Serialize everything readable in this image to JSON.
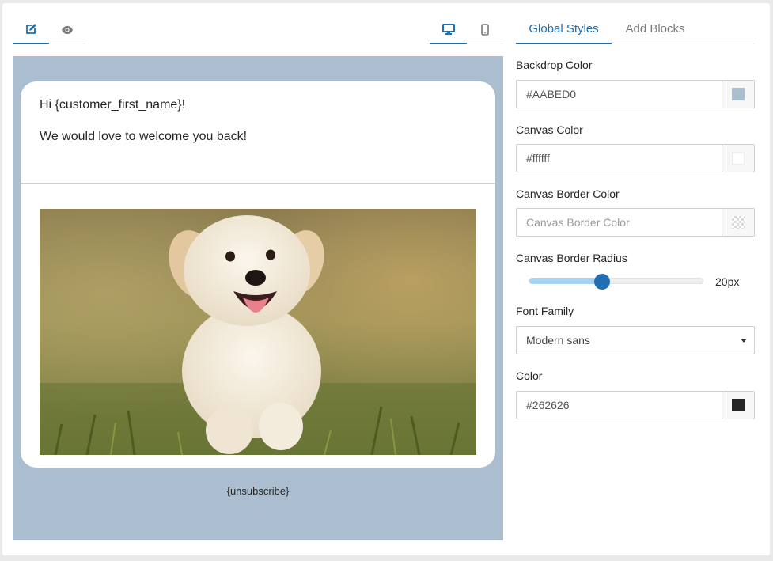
{
  "toolbar": {
    "edit_icon": "edit-pencil-icon",
    "preview_icon": "eye-icon",
    "desktop_icon": "desktop-monitor-icon",
    "mobile_icon": "mobile-phone-icon",
    "active_color": "#1f6fb2",
    "inactive_color": "#7a7a7a"
  },
  "email": {
    "greeting": "Hi {customer_first_name}!",
    "body": "We would love to welcome you back!",
    "image_icon": "puppy-photo",
    "footer": "{unsubscribe}"
  },
  "sidebar": {
    "tabs": [
      {
        "label": "Global Styles",
        "active": true
      },
      {
        "label": "Add Blocks",
        "active": false
      }
    ],
    "backdrop_color": {
      "label": "Backdrop Color",
      "value": "#AABED0"
    },
    "canvas_color": {
      "label": "Canvas Color",
      "value": "#ffffff"
    },
    "canvas_border_color": {
      "label": "Canvas Border Color",
      "placeholder": "Canvas Border Color",
      "value": ""
    },
    "canvas_border_radius": {
      "label": "Canvas Border Radius",
      "value": "20px",
      "level": 0.42
    },
    "font_family": {
      "label": "Font Family",
      "value": "Modern sans"
    },
    "text_color": {
      "label": "Color",
      "value": "#262626"
    }
  }
}
